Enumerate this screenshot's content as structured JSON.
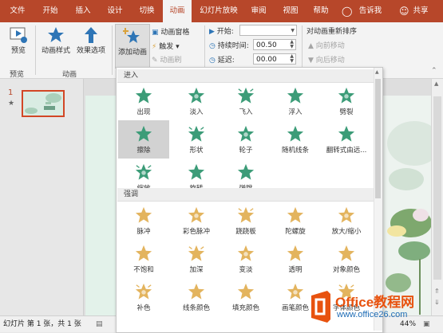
{
  "tabs": [
    "文件",
    "开始",
    "插入",
    "设计",
    "切换",
    "动画",
    "幻灯片放映",
    "审阅",
    "视图",
    "帮助",
    "告诉我",
    "共享"
  ],
  "ribbon": {
    "preview": "预览",
    "preview_group": "预览",
    "anim_style": "动画样式",
    "effect_options": "效果选项",
    "anim_group": "动画",
    "add_anim": "添加动画",
    "anim_pane": "动画窗格",
    "trigger": "触发",
    "anim_painter": "动画刷",
    "start_label": "开始:",
    "duration_label": "持续时间:",
    "duration_value": "00.50",
    "delay_label": "延迟:",
    "delay_value": "00.00",
    "reorder_title": "对动画重新排序",
    "move_earlier": "向前移动",
    "move_later": "向后移动"
  },
  "slide_thumb": {
    "number": "1",
    "star": "★"
  },
  "status": {
    "slide_info": "幻灯片 第 1 张，共 1 张",
    "zoom": "44%"
  },
  "dropdown": {
    "entrance_title": "进入",
    "entrance": [
      "出现",
      "淡入",
      "飞入",
      "浮入",
      "劈裂",
      "擦除",
      "形状",
      "轮子",
      "随机线条",
      "翻转式由远...",
      "缩放",
      "旋转",
      "弹跳"
    ],
    "emphasis_title": "强调",
    "emphasis": [
      "脉冲",
      "彩色脉冲",
      "跷跷板",
      "陀螺旋",
      "放大/缩小",
      "不饱和",
      "加深",
      "变淡",
      "透明",
      "对象颜色",
      "补色",
      "线条颜色",
      "填充颜色",
      "画笔颜色",
      "字体颜色"
    ]
  },
  "watermark": {
    "brand": "Office教程网",
    "url": "www.office26.com"
  },
  "colors": {
    "accent": "#b7472a",
    "entrance_star": "#3c9c78",
    "emphasis_star": "#e3b45e"
  }
}
